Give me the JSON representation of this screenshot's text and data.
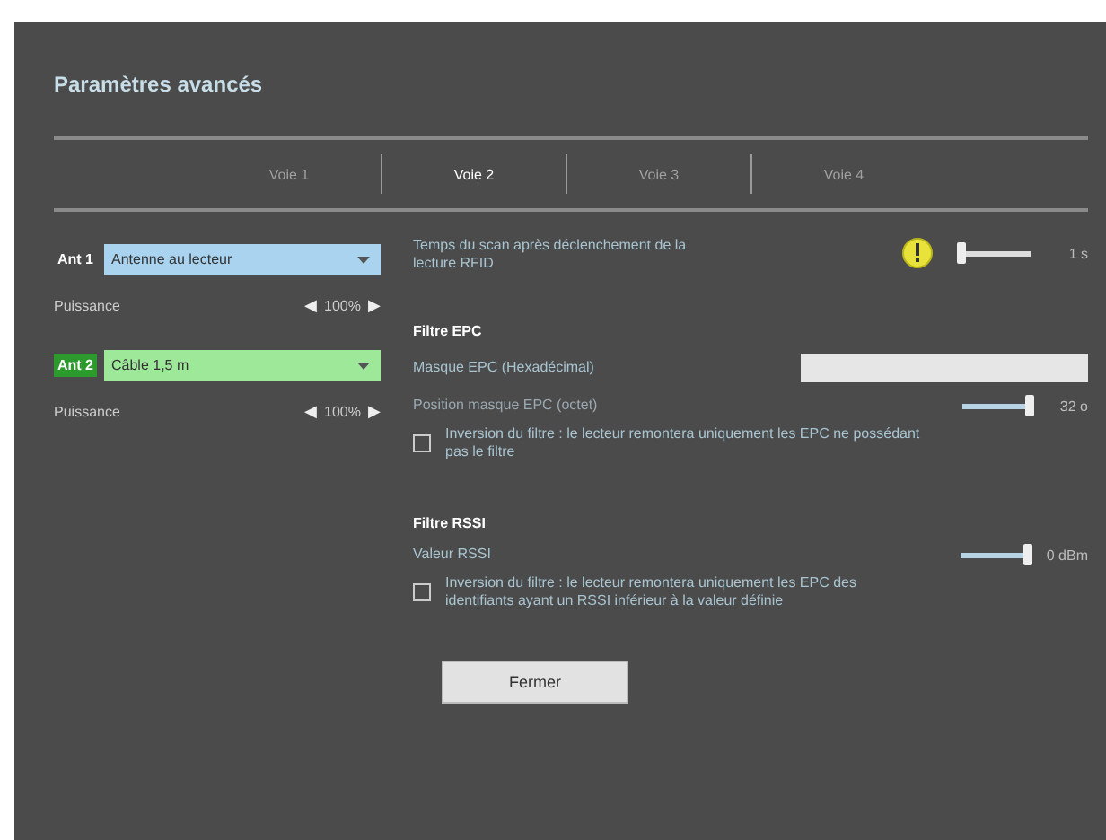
{
  "title": "Paramètres avancés",
  "tabs": [
    {
      "label": "Voie 1",
      "selected": false
    },
    {
      "label": "Voie 2",
      "selected": true
    },
    {
      "label": "Voie 3",
      "selected": false
    },
    {
      "label": "Voie 4",
      "selected": false
    }
  ],
  "antennas": [
    {
      "label": "Ant 1",
      "highlighted": false,
      "value": "Antenne au lecteur",
      "color": "#a9d3ef",
      "power_label": "Puissance",
      "power": "100%",
      "left": "◀",
      "right": "▶"
    },
    {
      "label": "Ant 2",
      "highlighted": true,
      "value": "Câble 1,5 m",
      "color": "#9ee89a",
      "power_label": "Puissance",
      "power": "100%",
      "left": "◀",
      "right": "▶"
    }
  ],
  "scan": {
    "label": "Temps du scan après déclenchement de la lecture RFID",
    "warning": true,
    "level": 0,
    "reading": "1 s"
  },
  "epc": {
    "heading": "Filtre EPC",
    "mask_label": "Masque EPC (Hexadécimal)",
    "position_label": "Position masque EPC (octet)",
    "level": 1,
    "reading": "32 o",
    "invert_checked": false,
    "invert_label": "Inversion du filtre : le lecteur remontera uniquement les EPC ne possédant pas le filtre"
  },
  "rssi": {
    "heading": "Filtre RSSI",
    "value_label": "Valeur RSSI",
    "level": 1,
    "reading": "0 dBm",
    "invert_checked": false,
    "invert_label": "Inversion du filtre : le lecteur remontera uniquement les EPC des identifiants ayant un RSSI inférieur à la valeur définie"
  },
  "close_button": "Fermer"
}
